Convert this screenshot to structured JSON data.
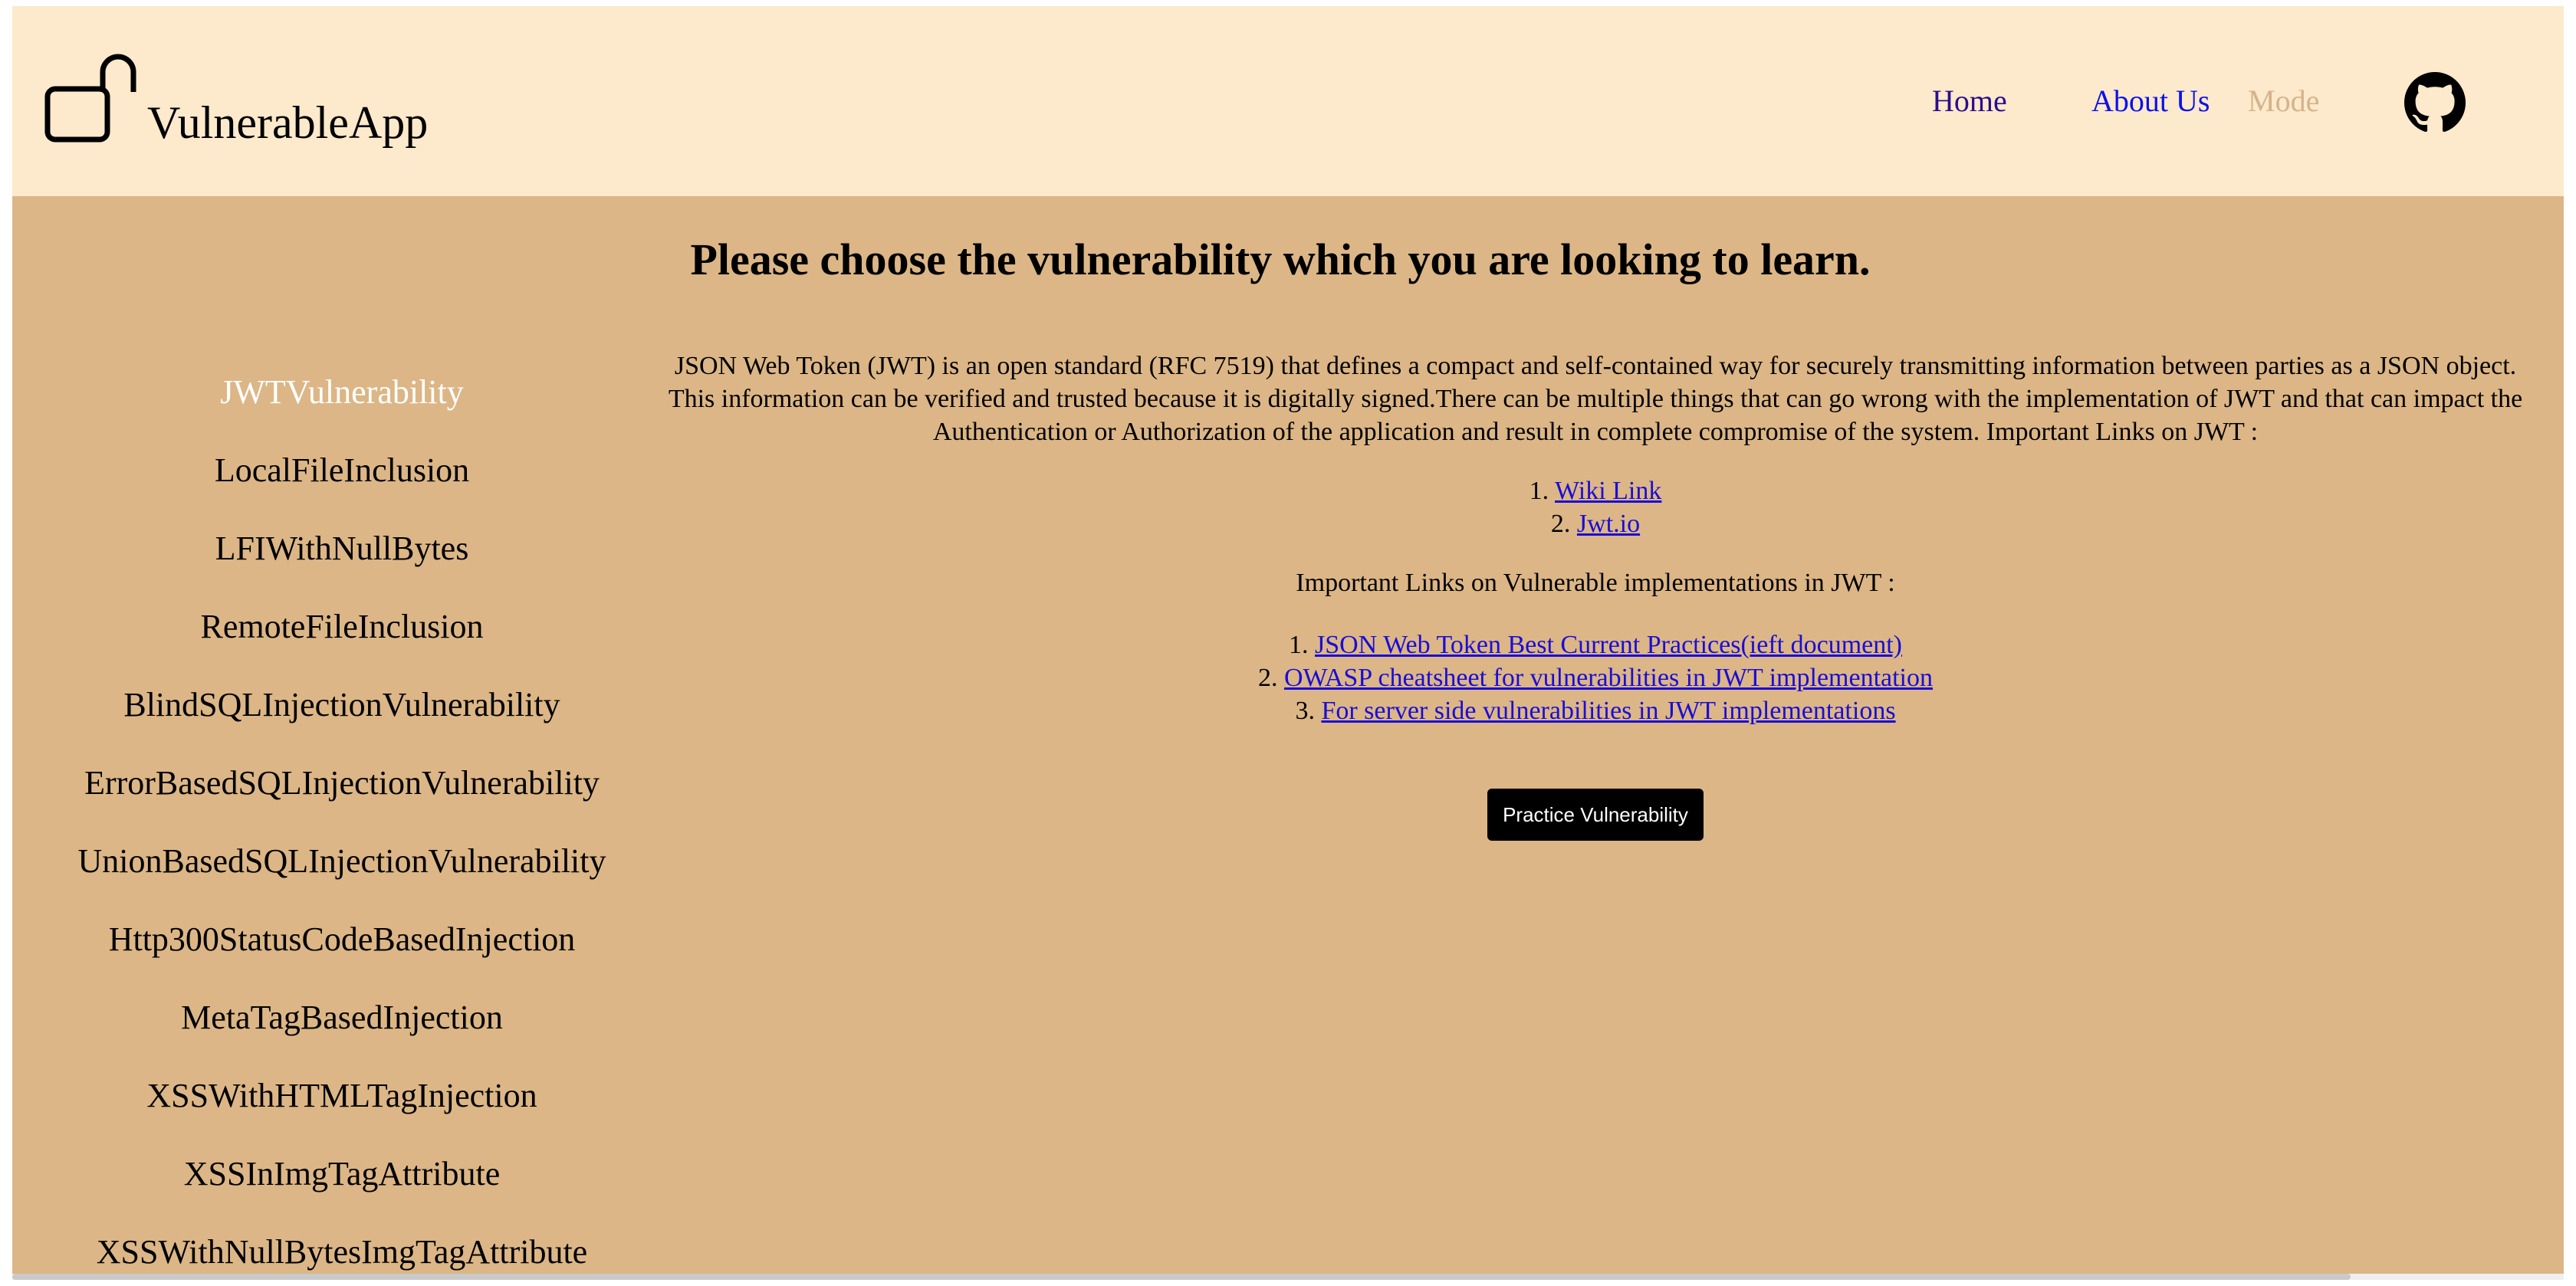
{
  "header": {
    "brand": "VulnerableApp",
    "nav": {
      "home": "Home",
      "about": "About Us",
      "mode": "Mode"
    },
    "icons": {
      "logo": "unlocked-padlock-icon",
      "github": "github-icon"
    }
  },
  "main": {
    "heading": "Please choose the vulnerability which you are looking to learn.",
    "sidebar": {
      "items": [
        "JWTVulnerability",
        "LocalFileInclusion",
        "LFIWithNullBytes",
        "RemoteFileInclusion",
        "BlindSQLInjectionVulnerability",
        "ErrorBasedSQLInjectionVulnerability",
        "UnionBasedSQLInjectionVulnerability",
        "Http300StatusCodeBasedInjection",
        "MetaTagBasedInjection",
        "XSSWithHTMLTagInjection",
        "XSSInImgTagAttribute",
        "XSSWithNullBytesImgTagAttribute"
      ],
      "active_index": 0
    },
    "content": {
      "description": "JSON Web Token (JWT) is an open standard (RFC 7519) that defines a compact and self-contained way for securely transmitting information between parties as a JSON object. This information can be verified and trusted because it is digitally signed.There can be multiple things that can go wrong with the implementation of JWT and that can impact the Authentication or Authorization of the application and result in complete compromise of the system. Important Links on JWT :",
      "links": [
        {
          "num": "1.",
          "text": "Wiki Link"
        },
        {
          "num": "2.",
          "text": "Jwt.io"
        }
      ],
      "vuln_heading": "Important Links on Vulnerable implementations in JWT :",
      "vuln_links": [
        {
          "num": "1.",
          "text": "JSON Web Token Best Current Practices(ieft document)"
        },
        {
          "num": "2.",
          "text": "OWASP cheatsheet for vulnerabilities in JWT implementation"
        },
        {
          "num": "3.",
          "text": "For server side vulnerabilities in JWT implementations"
        }
      ],
      "button": "Practice Vulnerability"
    }
  },
  "colors": {
    "header_bg": "#fde9cb",
    "body_bg": "#dcb686",
    "link": "#1a0dd6",
    "active_item": "#ffffff",
    "mode_link": "#d4b48a"
  }
}
